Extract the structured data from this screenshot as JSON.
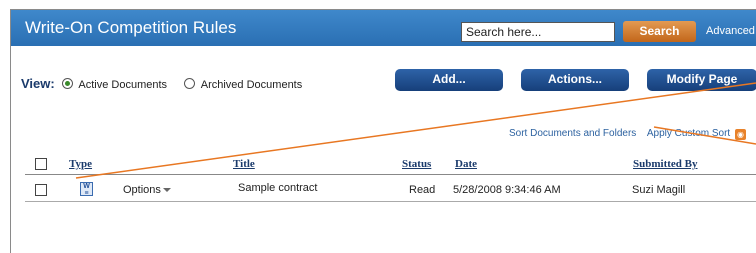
{
  "header": {
    "title": "Write-On Competition Rules",
    "search_placeholder": "Search here...",
    "search_button": "Search",
    "advanced_link": "Advanced"
  },
  "view": {
    "label": "View:",
    "options": [
      {
        "label": "Active Documents",
        "selected": true
      },
      {
        "label": "Archived Documents",
        "selected": false
      }
    ]
  },
  "toolbar": {
    "add": "Add...",
    "actions": "Actions...",
    "modify": "Modify Page"
  },
  "sort": {
    "sort_docs": "Sort Documents and Folders",
    "custom_sort": "Apply Custom Sort"
  },
  "table": {
    "columns": [
      "Type",
      "Title",
      "Status",
      "Date",
      "Submitted By"
    ],
    "rows": [
      {
        "type_icon": "word-doc-icon",
        "options": "Options",
        "title": "Sample contract",
        "status": "Read",
        "date": "5/28/2008 9:34:46 AM",
        "submitted_by": "Suzi Magill"
      }
    ]
  },
  "colors": {
    "title_bar": "#2a6fb3",
    "search_button": "#c2661a",
    "action_buttons": "#1f4f8f",
    "annotation_line": "#e87722"
  }
}
